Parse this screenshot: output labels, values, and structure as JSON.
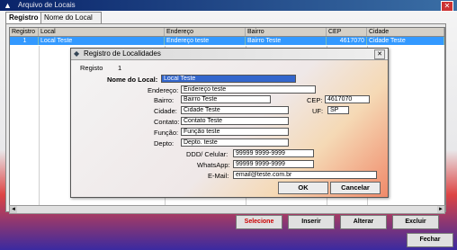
{
  "window": {
    "title": "Arquivo de Locais"
  },
  "tabs": [
    {
      "label": "Registro"
    },
    {
      "label": "Nome do Local"
    }
  ],
  "grid": {
    "columns": [
      "Registro",
      "Local",
      "Endereço",
      "Bairro",
      "CEP",
      "Cidade"
    ],
    "rows": [
      {
        "registro": "1",
        "local": "Local Teste",
        "endereco": "Endereço teste",
        "bairro": "Bairro Teste",
        "cep": "4617070",
        "cidade": "Cidade Teste"
      }
    ]
  },
  "main_buttons": {
    "select": "Selecione",
    "insert": "Inserir",
    "edit": "Alterar",
    "delete": "Excluir",
    "close": "Fechar"
  },
  "dialog": {
    "title": "Registro de Localidades",
    "registro_label": "Registo",
    "registro_value": "1",
    "nome_label": "Nome do Local:",
    "nome_value": "Local Teste",
    "endereco_label": "Endereço:",
    "endereco_value": "Endereço teste",
    "bairro_label": "Bairro:",
    "bairro_value": "Bairro Teste",
    "cep_label": "CEP:",
    "cep_value": "4617070",
    "cidade_label": "Cidade:",
    "cidade_value": "Cidade Teste",
    "uf_label": "UF:",
    "uf_value": "SP",
    "contato_label": "Contato:",
    "contato_value": "Contato Teste",
    "funcao_label": "Função:",
    "funcao_value": "Função teste",
    "depto_label": "Depto:",
    "depto_value": "Depto. teste",
    "ddd_label": "DDD/ Celular:",
    "ddd_value": "99999 9999-9999",
    "whatsapp_label": "WhatsApp:",
    "whatsapp_value": "99999 9999-9999",
    "email_label": "E-Mail:",
    "email_value": "email@teste.com.br",
    "ok_label": "OK",
    "cancel_label": "Cancelar"
  }
}
